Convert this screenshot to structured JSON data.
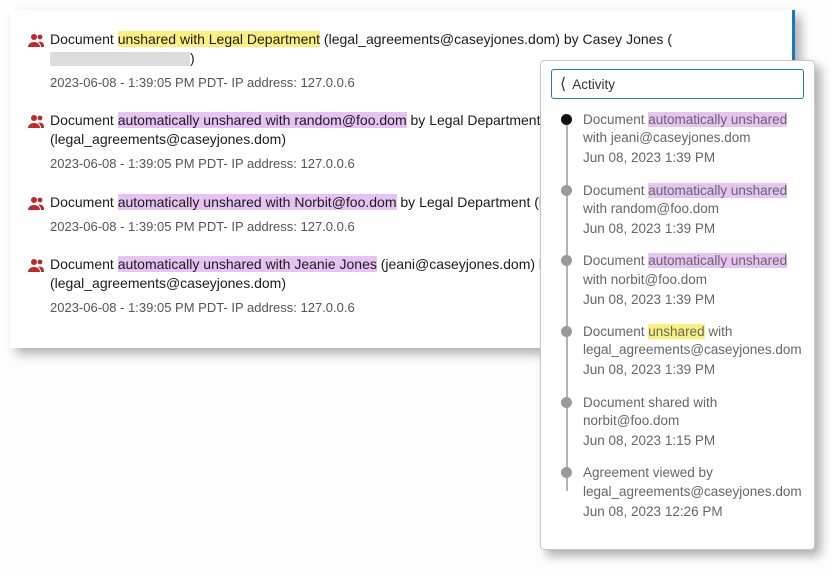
{
  "logs": [
    {
      "prefix": "Document ",
      "hl_text": "unshared with Legal Department",
      "hl_class": "hl-yellow",
      "mid": " (legal_agreements@caseyjones.dom) by Casey Jones",
      "has_redact": true,
      "meta": "2023-06-08 - 1:39:05 PM PDT- IP address: 127.0.0.6"
    },
    {
      "prefix": "Document ",
      "hl_text": "automatically unshared with random@foo.dom",
      "hl_class": "hl-purple",
      "mid": " by Legal Department (legal_agreements@caseyjones.dom)",
      "has_redact": false,
      "meta": "2023-06-08 - 1:39:05 PM PDT- IP address: 127.0.0.6"
    },
    {
      "prefix": "Document ",
      "hl_text": "automatically unshared with Norbit@foo.dom",
      "hl_class": "hl-purple",
      "mid": " by Legal Department (legal_agreements@caseyjones.dom)",
      "has_redact": false,
      "meta": "2023-06-08 - 1:39:05 PM PDT- IP address: 127.0.0.6"
    },
    {
      "prefix": "Document ",
      "hl_text": "automatically unshared with Jeanie Jones",
      "hl_class": "hl-purple",
      "mid": " (jeani@caseyjones.dom) by Legal Department (legal_agreements@caseyjones.dom)",
      "has_redact": false,
      "meta": "2023-06-08 - 1:39:05 PM PDT- IP address: 127.0.0.6"
    }
  ],
  "side": {
    "title": "Activity",
    "items": [
      {
        "pre": "Document ",
        "hl": "automatically unshared",
        "hlc": "hl-purple",
        "post": " with jeani@caseyjones.dom",
        "date": "Jun 08, 2023 1:39 PM"
      },
      {
        "pre": "Document ",
        "hl": "automatically unshared",
        "hlc": "hl-purple",
        "post": " with random@foo.dom",
        "date": "Jun 08, 2023 1:39 PM"
      },
      {
        "pre": "Document ",
        "hl": "automatically unshared",
        "hlc": "hl-purple",
        "post": " with norbit@foo.dom",
        "date": "Jun 08, 2023 1:39 PM"
      },
      {
        "pre": "Document ",
        "hl": "unshared",
        "hlc": "hl-yellow",
        "post": " with legal_agreements@caseyjones.dom",
        "date": "Jun 08, 2023 1:39 PM"
      },
      {
        "pre": "Document shared with norbit@foo.dom",
        "hl": "",
        "hlc": "",
        "post": "",
        "date": "Jun 08, 2023 1:15 PM"
      },
      {
        "pre": "Agreement viewed by legal_agreements@caseyjones.dom",
        "hl": "",
        "hlc": "",
        "post": "",
        "date": "Jun 08, 2023 12:26 PM"
      }
    ]
  }
}
